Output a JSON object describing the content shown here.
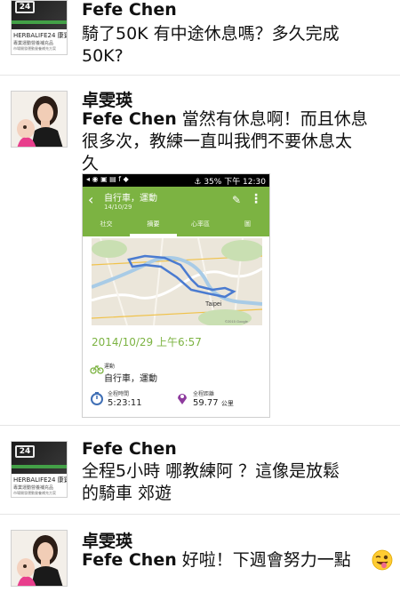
{
  "comments": [
    {
      "name": "Fefe Chen",
      "text_line1": "騎了50K 有中途休息嗎？多久完成",
      "text_line2": "50K?",
      "avatar": {
        "type": "herbalife",
        "logo": "24",
        "line1": "HERBALIFE24 康寶萊",
        "line2": "專業運動營養補充品",
        "line3": "市場開發運動營養補充方案"
      }
    },
    {
      "name": "卓雯瑛",
      "mention": "Fefe Chen",
      "text_line1": " 當然有休息啊！而且休息",
      "text_line2": "很多次，教練一直叫我們不要休息太",
      "text_line3": "久",
      "avatar": {
        "type": "woman"
      }
    },
    {
      "name": "Fefe Chen",
      "text_line1": "全程5小時  哪教練阿 ？這像是放鬆",
      "text_line2": "的騎車 郊遊",
      "avatar": {
        "type": "herbalife",
        "logo": "24",
        "line1": "HERBALIFE24 康寶萊",
        "line2": "專業運動營養補充品",
        "line3": "市場開發運動營養補充方案"
      }
    },
    {
      "name": "卓雯瑛",
      "mention": "Fefe Chen",
      "text_line1": " 好啦！下週會努力一點",
      "avatar": {
        "type": "woman"
      },
      "emoji": "winking-tongue-emoji"
    }
  ],
  "screenshot": {
    "status": {
      "left": "◂ ◉ ▣ ▤ f ◆",
      "right": "⚓ 35% 下午 12:30"
    },
    "app_title": "自行車，運動",
    "app_date": "14/10/29",
    "tabs": [
      "社交",
      "摘要",
      "心率區",
      "圖"
    ],
    "active_tab": 1,
    "map_label": "Taipei",
    "ride_datetime": "2014/10/29 上午6:57",
    "sport_label": "運動",
    "sport_value": "自行車，運動",
    "duration_label": "全程時間",
    "duration_value": "5:23:11",
    "distance_label": "全程距離",
    "distance_value": "59.77",
    "distance_unit": "公里",
    "accent_color": "#7cb342",
    "route_color": "#4a7bd0"
  }
}
